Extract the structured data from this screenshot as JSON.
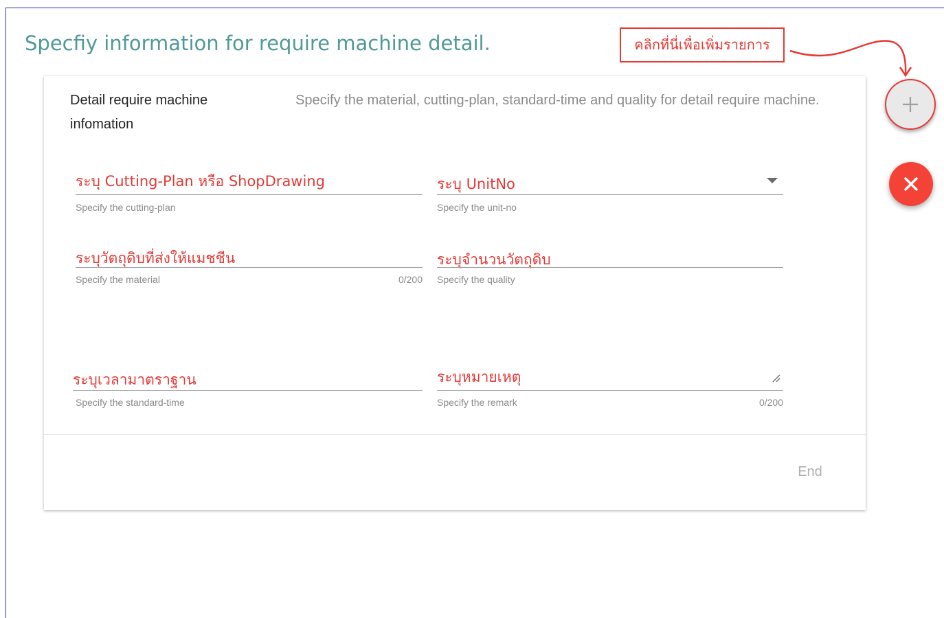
{
  "page": {
    "title": "Specfiy information for require machine detail."
  },
  "callout": {
    "text": "คลิกที่นี่เพื่อเพิ่มรายการ"
  },
  "fab": {
    "add_icon": "plus-icon",
    "close_icon": "close-icon"
  },
  "card": {
    "heading": "Detail require machine infomation",
    "description": "Specify the material, cutting-plan, standard-time and quality for detail require machine."
  },
  "fields": {
    "cutting_plan": {
      "value": "ระบุ Cutting-Plan หรือ ShopDrawing",
      "hint": "Specify the cutting-plan"
    },
    "unit_no": {
      "value": "ระบุ UnitNo",
      "hint": "Specify the unit-no"
    },
    "material": {
      "value": "ระบุวัตถุดิบที่ส่งให้แมชชีน",
      "hint": "Specify the material",
      "counter": "0/200"
    },
    "quality": {
      "value": "ระบุจำนวนวัตถุดิบ",
      "hint": "Specify the quality"
    },
    "standard_time": {
      "value": "ระบุเวลามาตราฐาน",
      "hint": "Specify the standard-time"
    },
    "remark": {
      "value": "ระบุหมายเหตุ",
      "hint": "Specify the remark",
      "counter": "0/200"
    }
  },
  "actions": {
    "end_label": "End"
  },
  "colors": {
    "title": "#4f9a98",
    "annotation_red": "#e53935",
    "fab_close": "#f44336"
  }
}
